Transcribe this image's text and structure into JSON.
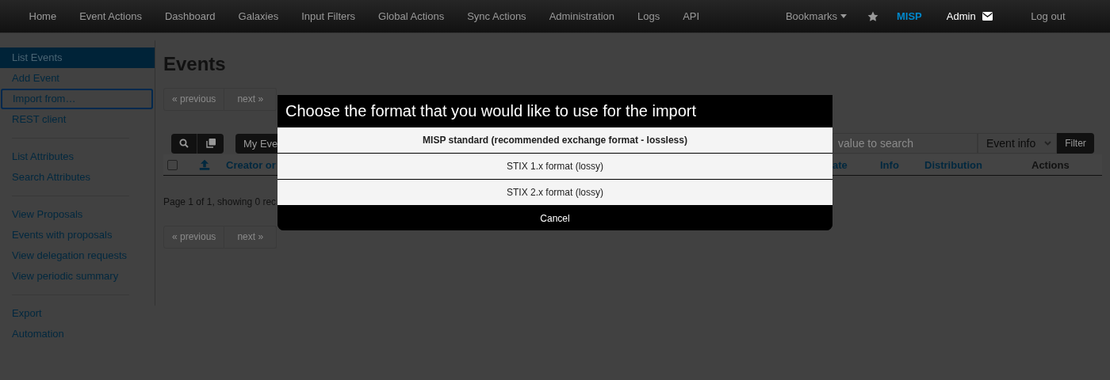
{
  "navbar": {
    "items": [
      "Home",
      "Event Actions",
      "Dashboard",
      "Galaxies",
      "Input Filters",
      "Global Actions",
      "Sync Actions",
      "Administration",
      "Logs",
      "API"
    ],
    "bookmarks": "Bookmarks",
    "brand": "MISP",
    "user": "Admin",
    "logout": "Log out"
  },
  "sidebar": {
    "groups": [
      [
        {
          "label": "List Events",
          "selected": true,
          "focused": false
        },
        {
          "label": "Add Event",
          "selected": false,
          "focused": false
        },
        {
          "label": "Import from…",
          "selected": false,
          "focused": true
        },
        {
          "label": "REST client",
          "selected": false,
          "focused": false
        }
      ],
      [
        {
          "label": "List Attributes",
          "selected": false,
          "focused": false
        },
        {
          "label": "Search Attributes",
          "selected": false,
          "focused": false
        }
      ],
      [
        {
          "label": "View Proposals",
          "selected": false,
          "focused": false
        },
        {
          "label": "Events with proposals",
          "selected": false,
          "focused": false
        },
        {
          "label": "View delegation requests",
          "selected": false,
          "focused": false
        },
        {
          "label": "View periodic summary",
          "selected": false,
          "focused": false
        }
      ],
      [
        {
          "label": "Export",
          "selected": false,
          "focused": false
        },
        {
          "label": "Automation",
          "selected": false,
          "focused": false
        }
      ]
    ]
  },
  "main": {
    "title": "Events",
    "pagination_top": {
      "previous": "« previous",
      "next": "next »"
    },
    "toolbar": {
      "my_events": "My Eve",
      "search": {
        "placeholder": "value to search"
      },
      "filter_select": "Event info",
      "filter_button": "Filter"
    },
    "table": {
      "select_all_checked": false,
      "columns_left": [
        "Creator or"
      ],
      "columns_right": [
        "ate",
        "Info",
        "Distribution",
        "Actions"
      ]
    },
    "status_text": "Page 1 of 1, showing 0 rec",
    "pagination_bottom": {
      "previous": "« previous",
      "next": "next »"
    }
  },
  "modal": {
    "title": "Choose the format that you would like to use for the import",
    "options": [
      {
        "label": "MISP standard (recommended exchange format - lossless)",
        "emphasized": true
      },
      {
        "label": "STIX 1.x format (lossy)",
        "emphasized": false
      },
      {
        "label": "STIX 2.x format (lossy)",
        "emphasized": false
      }
    ],
    "cancel": "Cancel"
  }
}
